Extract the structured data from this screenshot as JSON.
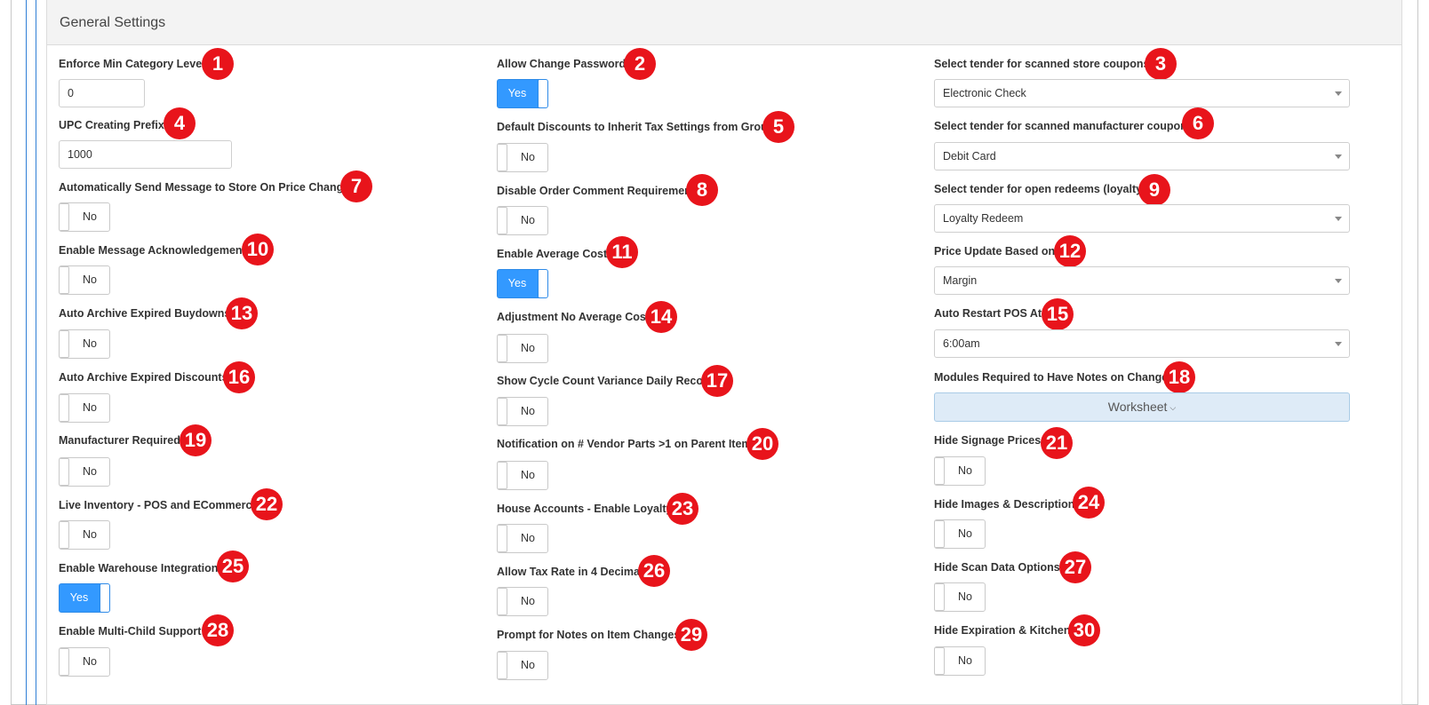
{
  "panel": {
    "title": "General Settings"
  },
  "toggle_text": {
    "yes": "Yes",
    "no": "No"
  },
  "colors": {
    "badge": "#e8141b",
    "toggle_on": "#3399ff",
    "header_bg": "#f3f3f3",
    "accent_line": "#2f7fd6"
  },
  "fields": {
    "f1": {
      "label": "Enforce Min Category Level:",
      "badge": "1",
      "value": "0"
    },
    "f2": {
      "label": "Allow Change Password:",
      "badge": "2",
      "state": "Yes"
    },
    "f3": {
      "label": "Select tender for scanned store coupons:",
      "badge": "3",
      "value": "Electronic Check"
    },
    "f4": {
      "label": "UPC Creating Prefix:",
      "badge": "4",
      "value": "1000"
    },
    "f5": {
      "label": "Default Discounts to Inherit Tax Settings from Group:",
      "badge": "5",
      "state": "No"
    },
    "f6": {
      "label": "Select tender for scanned manufacturer coupons:",
      "badge": "6",
      "value": "Debit Card"
    },
    "f7": {
      "label": "Automatically Send Message to Store On Price Changes:",
      "badge": "7",
      "state": "No"
    },
    "f8": {
      "label": "Disable Order Comment Requirement:",
      "badge": "8",
      "state": "No"
    },
    "f9": {
      "label": "Select tender for open redeems (loyalty):",
      "badge": "9",
      "value": "Loyalty Redeem"
    },
    "f10": {
      "label": "Enable Message Acknowledgement:",
      "badge": "10",
      "state": "No"
    },
    "f11": {
      "label": "Enable Average Cost:",
      "badge": "11",
      "state": "Yes"
    },
    "f12": {
      "label": "Price Update Based on:",
      "badge": "12",
      "value": "Margin"
    },
    "f13": {
      "label": "Auto Archive Expired Buydowns:",
      "badge": "13",
      "state": "No"
    },
    "f14": {
      "label": "Adjustment No Average Cost:",
      "badge": "14",
      "state": "No"
    },
    "f15": {
      "label": "Auto Restart POS At:",
      "badge": "15",
      "value": "6:00am"
    },
    "f16": {
      "label": "Auto Archive Expired Discounts:",
      "badge": "16",
      "state": "No"
    },
    "f17": {
      "label": "Show Cycle Count Variance Daily Recon:",
      "badge": "17",
      "state": "No"
    },
    "f18": {
      "label": "Modules Required to Have Notes on Changes",
      "badge": "18",
      "value": "Worksheet"
    },
    "f19": {
      "label": "Manufacturer Required:",
      "badge": "19",
      "state": "No"
    },
    "f20": {
      "label": "Notification on # Vendor Parts >1 on Parent Items:",
      "badge": "20",
      "state": "No"
    },
    "f21": {
      "label": "Hide Signage Prices:",
      "badge": "21",
      "state": "No"
    },
    "f22": {
      "label": "Live Inventory - POS and ECommerce:",
      "badge": "22",
      "state": "No"
    },
    "f23": {
      "label": "House Accounts - Enable Loyalty:",
      "badge": "23",
      "state": "No"
    },
    "f24": {
      "label": "Hide Images & Description:",
      "badge": "24",
      "state": "No"
    },
    "f25": {
      "label": "Enable Warehouse Integration:",
      "badge": "25",
      "state": "Yes"
    },
    "f26": {
      "label": "Allow Tax Rate in 4 Decimal:",
      "badge": "26",
      "state": "No"
    },
    "f27": {
      "label": "Hide Scan Data Options:",
      "badge": "27",
      "state": "No"
    },
    "f28": {
      "label": "Enable Multi-Child Support:",
      "badge": "28",
      "state": "No"
    },
    "f29": {
      "label": "Prompt for Notes on Item Changes:",
      "badge": "29",
      "state": "No"
    },
    "f30": {
      "label": "Hide Expiration & Kitchen:",
      "badge": "30",
      "state": "No"
    }
  }
}
